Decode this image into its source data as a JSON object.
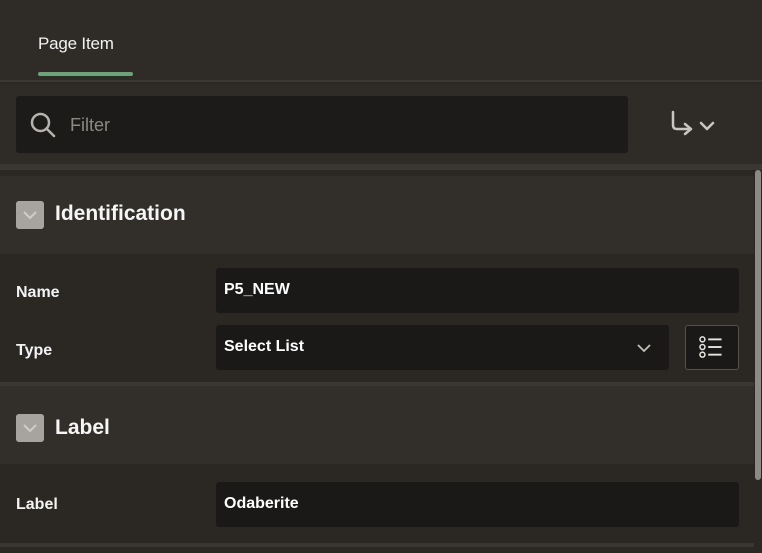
{
  "tabs": [
    {
      "label": "Page Item"
    }
  ],
  "filter": {
    "placeholder": "Filter"
  },
  "sections": {
    "identification": {
      "title": "Identification",
      "name_label": "Name",
      "name_value": "P5_NEW",
      "type_label": "Type",
      "type_value": "Select List"
    },
    "label": {
      "title": "Label",
      "label_label": "Label",
      "label_value": "Odaberite"
    }
  },
  "icons": {
    "filter": "search-icon",
    "goto": "goto-group-icon",
    "section_toggle": "collapse-checkbox-icon",
    "type_dropdown": "chevron-down-icon",
    "list_of_values": "list-icon"
  },
  "colors": {
    "accent_underline": "#6aa57a",
    "background": "#2b2824",
    "field_background": "#1b1917"
  }
}
